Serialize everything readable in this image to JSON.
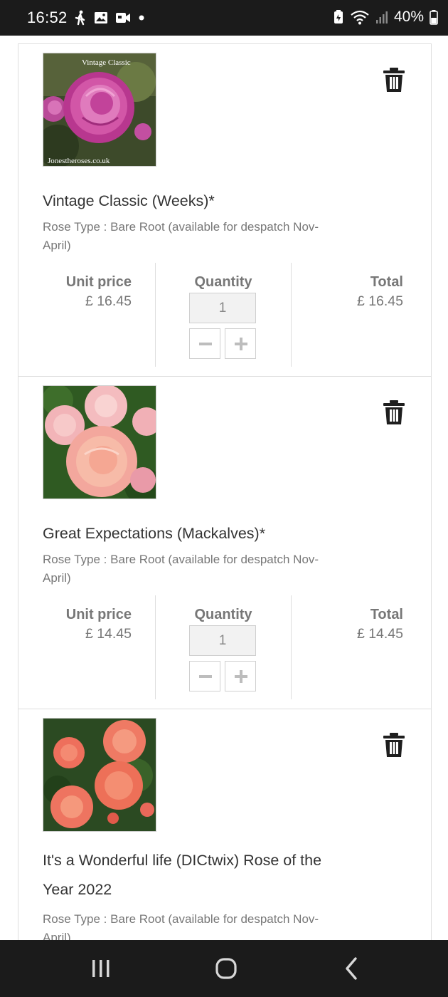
{
  "status_bar": {
    "time": "16:52",
    "battery": "40%",
    "left_icons": [
      "walking-icon",
      "image-icon",
      "video-icon",
      "dot-icon"
    ],
    "right_icons": [
      "battery-saver-icon",
      "wifi-icon",
      "signal-icon",
      "battery-icon"
    ]
  },
  "cart": {
    "unit_price_label": "Unit price",
    "quantity_label": "Quantity",
    "total_label": "Total",
    "items": [
      {
        "title": "Vintage Classic (Weeks)*",
        "rose_type": "Rose Type : Bare Root (available for despatch Nov-April)",
        "unit_price": "£ 16.45",
        "quantity": "1",
        "total": "£ 16.45",
        "image_caption_top": "Vintage Classic",
        "image_caption_bottom": "Jonestheroses.co.uk"
      },
      {
        "title": "Great Expectations (Mackalves)*",
        "rose_type": "Rose Type : Bare Root (available for despatch Nov-April)",
        "unit_price": "£ 14.45",
        "quantity": "1",
        "total": "£ 14.45"
      },
      {
        "title": "It's a Wonderful life (DICtwix) Rose of the Year 2022",
        "rose_type": "Rose Type : Bare Root (available for despatch Nov-April)"
      }
    ]
  },
  "colors": {
    "system_bar": "#1b1b1b",
    "text_dark": "#333333",
    "text_muted": "#777777",
    "border": "#dedede"
  }
}
